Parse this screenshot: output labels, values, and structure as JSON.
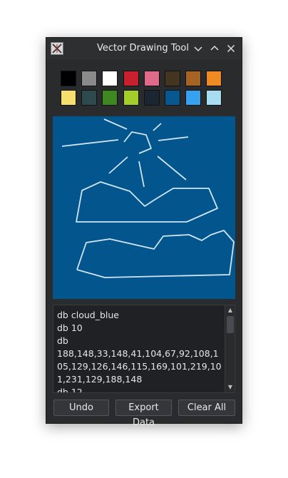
{
  "window": {
    "title": "Vector Drawing Tool"
  },
  "palette": [
    "#000000",
    "#8a8a8a",
    "#ffffff",
    "#c8202e",
    "#e06a8a",
    "#43351f",
    "#a56421",
    "#f08b24",
    "#f7df6f",
    "#2d4a4e",
    "#3f8720",
    "#a3cd2a",
    "#1c2532",
    "#075790",
    "#35a2f0",
    "#a8dcf0"
  ],
  "canvas": {
    "background": "#03558d",
    "stroke": "#cfe4f4"
  },
  "log": {
    "text": "db cloud_blue\ndb 10\ndb\n188,148,33,148,41,104,67,92,108,105,129,126,146,115,169,101,219,101,231,129,188,148\ndb 12"
  },
  "buttons": {
    "undo": "Undo",
    "export": "Export Data",
    "clear": "Clear All"
  }
}
